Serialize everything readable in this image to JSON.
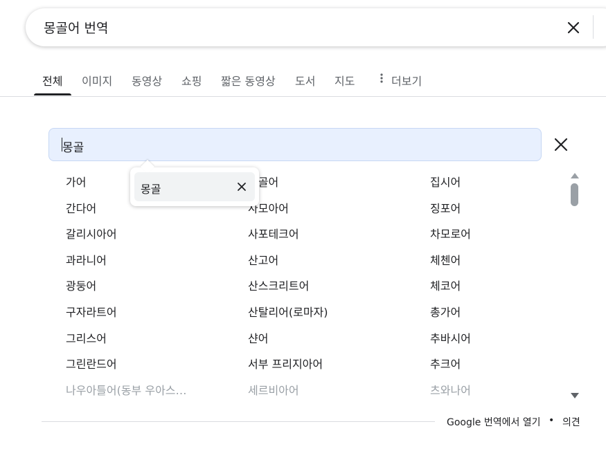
{
  "search": {
    "query": "몽골어 번역"
  },
  "tabs": [
    {
      "label": "전체"
    },
    {
      "label": "이미지"
    },
    {
      "label": "동영상"
    },
    {
      "label": "쇼핑"
    },
    {
      "label": "짧은 동영상"
    },
    {
      "label": "도서"
    },
    {
      "label": "지도"
    },
    {
      "label": "더보기"
    }
  ],
  "translate": {
    "lang_input_value": "몽골",
    "columns": [
      [
        "가어",
        "간다어",
        "갈리시아어",
        "과라니어",
        "광둥어",
        "구자라트어",
        "그리스어",
        "그린란드어",
        "나우아틀어(동부 우아스…"
      ],
      [
        "몽골어",
        "사모아어",
        "사포테크어",
        "산고어",
        "산스크리트어",
        "산탈리어(로마자)",
        "샨어",
        "서부 프리지아어",
        "세르비아어"
      ],
      [
        "집시어",
        "징포어",
        "차모로어",
        "체첸어",
        "체코어",
        "총가어",
        "추바시어",
        "추크어",
        "츠와나어"
      ]
    ],
    "popup_text": "몽골"
  },
  "footer": {
    "open_translate": "Google 번역에서 열기",
    "separator": "•",
    "feedback": "의견"
  }
}
